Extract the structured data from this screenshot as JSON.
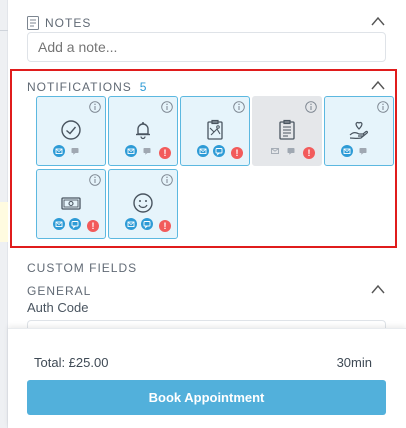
{
  "notes": {
    "heading": "NOTES",
    "placeholder": "Add a note..."
  },
  "notifications": {
    "heading": "NOTIFICATIONS",
    "count": "5",
    "cards": [
      {
        "icon": "check-circle-icon",
        "email": true,
        "sms": false,
        "alert": false,
        "disabled": false
      },
      {
        "icon": "bell-icon",
        "email": true,
        "sms": false,
        "alert": true,
        "disabled": false
      },
      {
        "icon": "clipboard-map-icon",
        "email": true,
        "sms": true,
        "alert": true,
        "disabled": false
      },
      {
        "icon": "clipboard-list-icon",
        "email": false,
        "sms": false,
        "alert": true,
        "disabled": true
      },
      {
        "icon": "hand-heart-icon",
        "email": true,
        "sms": false,
        "alert": false,
        "disabled": false
      },
      {
        "icon": "cash-icon",
        "email": true,
        "sms": true,
        "alert": true,
        "disabled": false
      },
      {
        "icon": "smiley-icon",
        "email": true,
        "sms": true,
        "alert": true,
        "disabled": false
      }
    ],
    "alert_glyph": "!"
  },
  "custom_fields": {
    "heading": "CUSTOM FIELDS",
    "general_heading": "GENERAL",
    "auth_code_label": "Auth Code"
  },
  "footer": {
    "total": "Total: £25.00",
    "duration": "30min",
    "book_label": "Book Appointment"
  },
  "colors": {
    "accent": "#2e9bd6",
    "button": "#52b0db",
    "highlight": "#e01c1c",
    "alert": "#f25b5b"
  }
}
